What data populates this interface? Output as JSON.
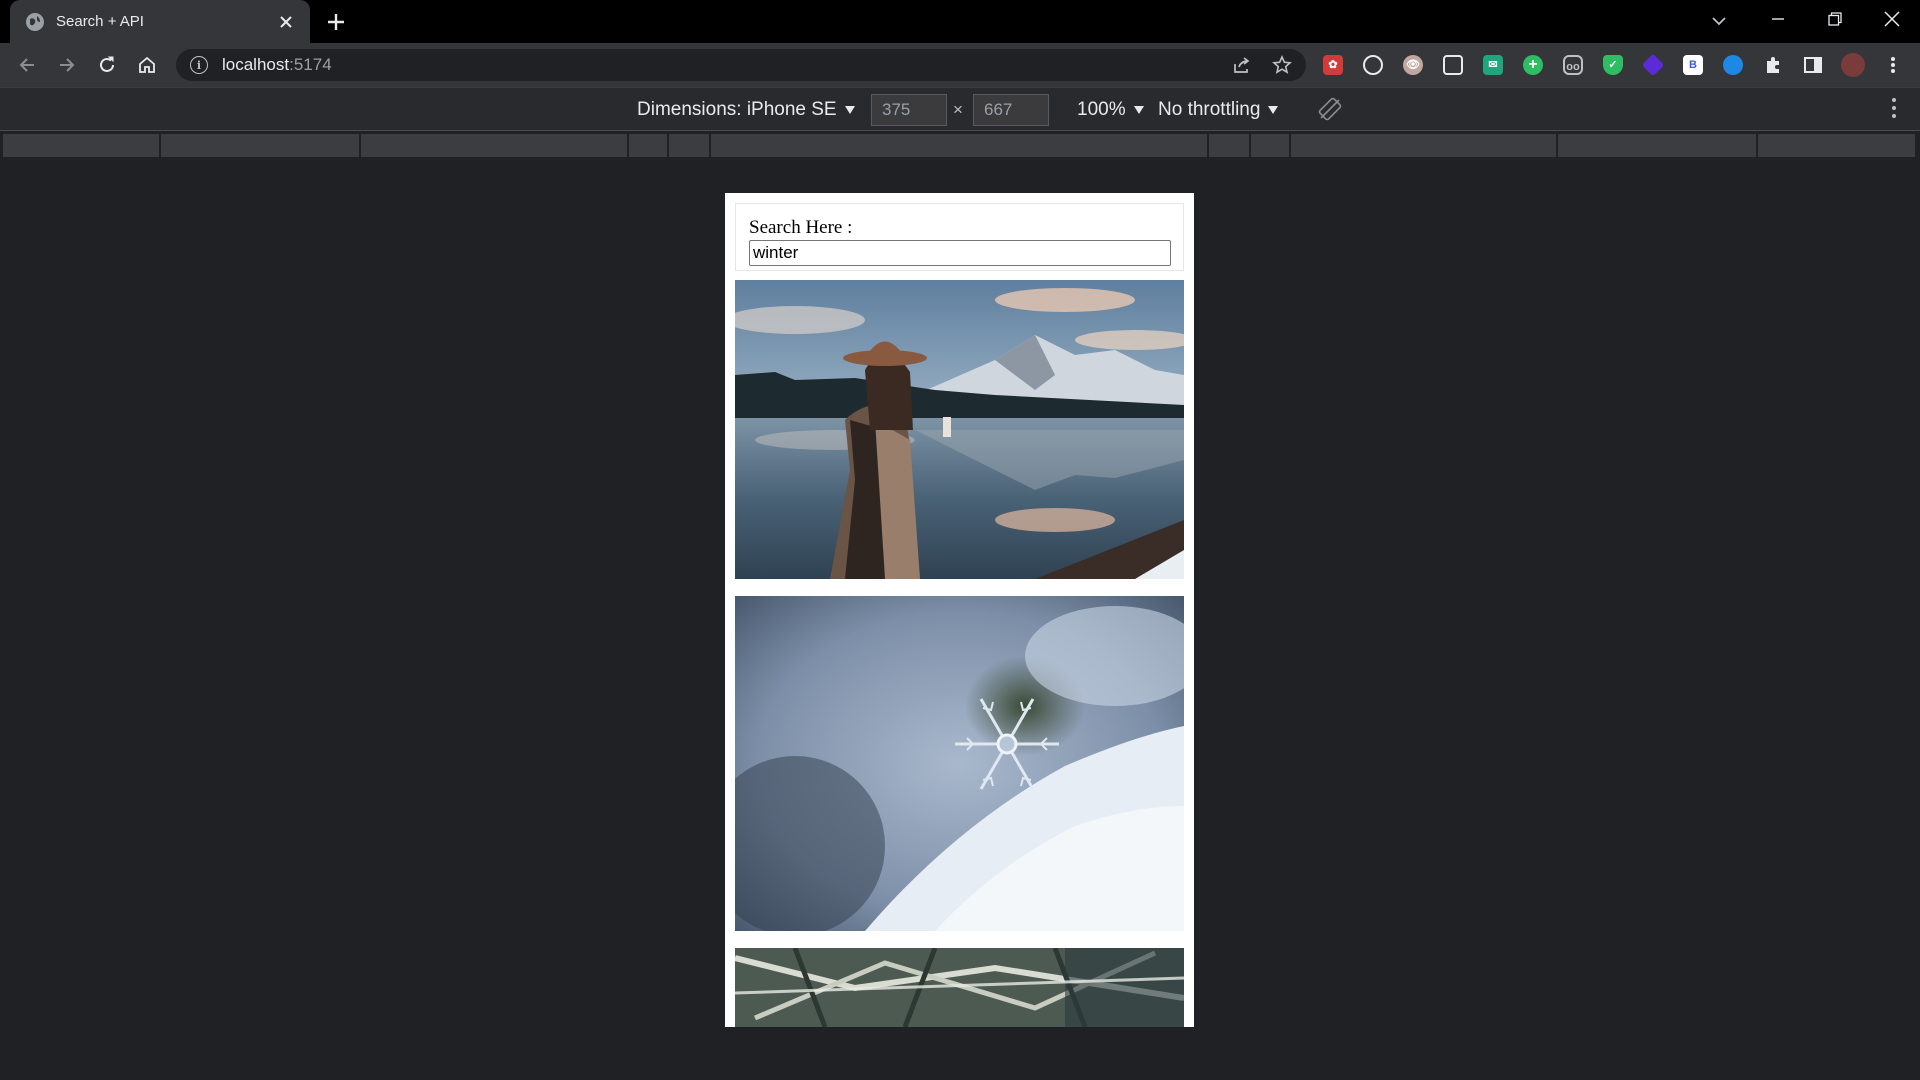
{
  "browser": {
    "tab": {
      "title": "Search + API",
      "favicon": "globe-icon"
    },
    "url": {
      "host": "localhost",
      "port": ":5174"
    },
    "extensions": [
      "ext-red-icon",
      "github-icon",
      "eye-icon",
      "window-icon",
      "mail-icon",
      "plus-circle-icon",
      "glasses-icon",
      "shield-icon",
      "purple-diamond-icon",
      "b-icon",
      "blue-circle-icon",
      "puzzle-icon",
      "sidepanel-icon",
      "profile-avatar"
    ]
  },
  "devtools": {
    "dimensions_label": "Dimensions: iPhone SE",
    "width": "375",
    "height": "667",
    "times": "×",
    "zoom": "100%",
    "throttling": "No throttling"
  },
  "page": {
    "search_label": "Search Here :",
    "search_value": "winter",
    "photos": [
      {
        "subject": "woman in hat and blanket by mountain lake"
      },
      {
        "subject": "snowflake close-up"
      },
      {
        "subject": "snowy pine branches"
      }
    ]
  },
  "colors": {
    "chrome_bg": "#202124",
    "tab_active": "#35363a",
    "page_bg": "#ffffff"
  }
}
